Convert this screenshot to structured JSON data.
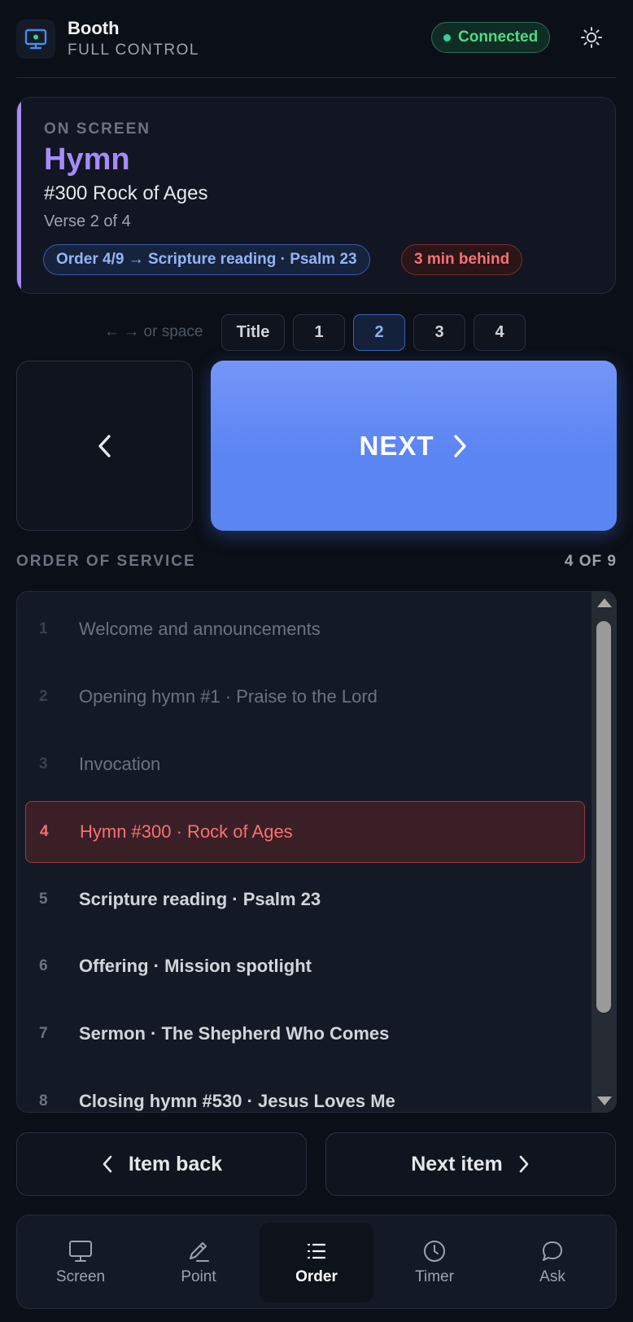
{
  "header": {
    "title": "Booth",
    "subtitle": "FULL CONTROL",
    "status": "Connected",
    "app_icon": "monitor-icon",
    "theme_icon": "sun-icon"
  },
  "on_screen": {
    "label": "ON SCREEN",
    "kind": "Hymn",
    "title": "#300 Rock of Ages",
    "verse": "Verse 2 of 4",
    "order_badge": "Order 4/9 → Scripture reading · Psalm 23",
    "behind_badge": "3 min behind"
  },
  "verse_selector": {
    "hint": "← → or space",
    "buttons": [
      "Title",
      "1",
      "2",
      "3",
      "4"
    ],
    "active": "2"
  },
  "controls": {
    "next_label": "NEXT"
  },
  "order_of_service": {
    "title": "ORDER OF SERVICE",
    "count": "4 OF 9",
    "items": [
      {
        "num": "1",
        "text": "Welcome and announcements",
        "state": "past"
      },
      {
        "num": "2",
        "text": "Opening hymn #1 · Praise to the Lord",
        "state": "past"
      },
      {
        "num": "3",
        "text": "Invocation",
        "state": "past"
      },
      {
        "num": "4",
        "text": "Hymn #300 · Rock of Ages",
        "state": "current"
      },
      {
        "num": "5",
        "text": "Scripture reading · Psalm 23",
        "state": "upcoming"
      },
      {
        "num": "6",
        "text": "Offering · Mission spotlight",
        "state": "upcoming"
      },
      {
        "num": "7",
        "text": "Sermon · The Shepherd Who Comes",
        "state": "upcoming"
      },
      {
        "num": "8",
        "text": "Closing hymn #530 · Jesus Loves Me",
        "state": "upcoming"
      }
    ]
  },
  "item_nav": {
    "back_label": "Item back",
    "next_label": "Next item"
  },
  "bottom_nav": {
    "items": [
      {
        "label": "Screen",
        "icon": "monitor-icon"
      },
      {
        "label": "Point",
        "icon": "pen-icon"
      },
      {
        "label": "Order",
        "icon": "list-icon"
      },
      {
        "label": "Timer",
        "icon": "clock-icon"
      },
      {
        "label": "Ask",
        "icon": "chat-bubble-icon"
      }
    ],
    "active": "Order"
  },
  "colors": {
    "background": "#0b0f17",
    "accent_purple": "#a78bfa",
    "accent_blue": "#5b85f3",
    "status_green": "#4ade80",
    "alert_red": "#f87171"
  }
}
